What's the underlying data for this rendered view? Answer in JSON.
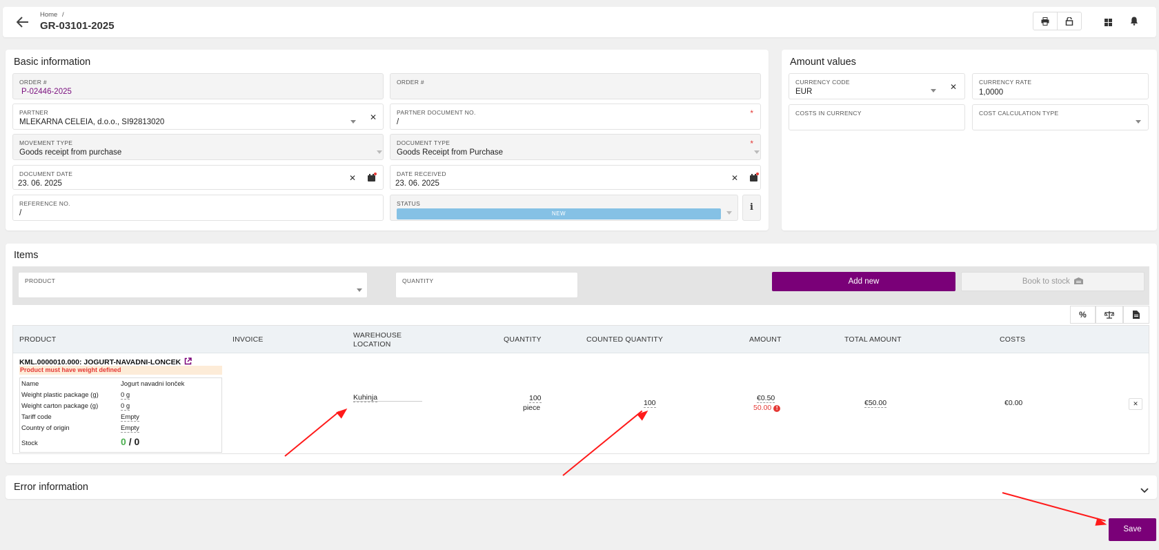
{
  "header": {
    "breadcrumb_home": "Home",
    "breadcrumb_sep": "/",
    "title": "GR-03101-2025"
  },
  "basic": {
    "title": "Basic information",
    "order1_label": "ORDER #",
    "order1_value": "P-02446-2025",
    "order2_label": "ORDER #",
    "partner_label": "PARTNER",
    "partner_value": "MLEKARNA CELEIA, d.o.o., SI92813020",
    "partner_doc_label": "PARTNER DOCUMENT NO.",
    "partner_doc_value": "/",
    "movement_label": "MOVEMENT TYPE",
    "movement_value": "Goods receipt from purchase",
    "doctype_label": "DOCUMENT TYPE",
    "doctype_value": "Goods Receipt from Purchase",
    "docdate_label": "DOCUMENT DATE",
    "docdate_value": "23. 06. 2025",
    "daterec_label": "DATE RECEIVED",
    "daterec_value": "23. 06. 2025",
    "reference_label": "REFERENCE NO.",
    "reference_value": "/",
    "status_label": "STATUS",
    "status_value": "NEW",
    "status_color": "#85c1e5"
  },
  "amounts": {
    "title": "Amount values",
    "currency_code_label": "CURRENCY CODE",
    "currency_code_value": "EUR",
    "currency_rate_label": "CURRENCY RATE",
    "currency_rate_value": "1,0000",
    "costs_label": "COSTS IN CURRENCY",
    "cost_calc_label": "COST CALCULATION TYPE"
  },
  "items": {
    "title": "Items",
    "product_label": "PRODUCT",
    "quantity_label": "QUANTITY",
    "add_new": "Add new",
    "book_to_stock": "Book to stock",
    "accent_color": "#7a0078",
    "columns": {
      "product": "PRODUCT",
      "invoice": "INVOICE",
      "warehouse_1": "WAREHOUSE",
      "warehouse_2": "LOCATION",
      "quantity": "QUANTITY",
      "counted": "COUNTED QUANTITY",
      "amount": "AMOUNT",
      "total": "TOTAL AMOUNT",
      "costs": "COSTS"
    },
    "row": {
      "product_code": "KML.0000010.000: JOGURT-NAVADNI-LONCEK",
      "warning": "Product must have weight defined",
      "details": [
        {
          "k": "Name",
          "v": "Jogurt navadni lonček"
        },
        {
          "k": "Weight plastic package (g)",
          "v": "0 g"
        },
        {
          "k": "Weight carton package (g)",
          "v": "0 g"
        },
        {
          "k": "Tariff code",
          "v": "Empty"
        },
        {
          "k": "Country of origin",
          "v": "Empty"
        }
      ],
      "stock_label": "Stock",
      "stock_green": "0",
      "stock_sep": "/",
      "stock_total": "0",
      "warehouse": "Kuhinja",
      "quantity": "100",
      "unit": "piece",
      "counted": "100",
      "amount": "€0.50",
      "amount_alt": "50.00",
      "total": "€50.00",
      "costs": "€0.00"
    }
  },
  "error_section": {
    "title": "Error information"
  },
  "save_label": "Save"
}
